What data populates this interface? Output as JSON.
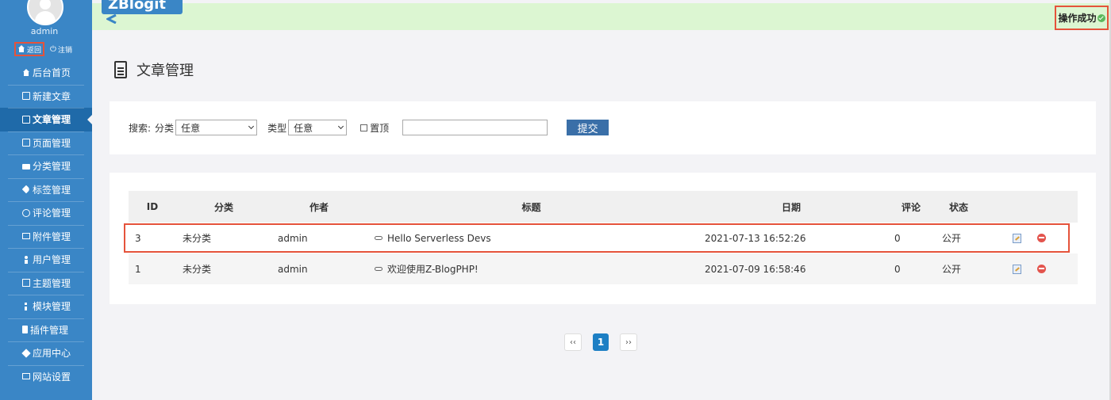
{
  "user": {
    "name": "admin",
    "back_label": "返回",
    "logout_label": "注销"
  },
  "logo": {
    "text": "ZBlogit"
  },
  "sidebar": {
    "items": [
      {
        "label": "后台首页",
        "icon": "home-icon"
      },
      {
        "label": "新建文章",
        "icon": "edit-icon"
      },
      {
        "label": "文章管理",
        "icon": "document-icon",
        "active": true
      },
      {
        "label": "页面管理",
        "icon": "page-icon"
      },
      {
        "label": "分类管理",
        "icon": "folder-icon"
      },
      {
        "label": "标签管理",
        "icon": "tag-icon"
      },
      {
        "label": "评论管理",
        "icon": "comment-icon"
      },
      {
        "label": "附件管理",
        "icon": "attachment-icon"
      },
      {
        "label": "用户管理",
        "icon": "user-icon"
      },
      {
        "label": "主题管理",
        "icon": "theme-icon"
      },
      {
        "label": "模块管理",
        "icon": "module-icon"
      },
      {
        "label": "插件管理",
        "icon": "plugin-icon"
      },
      {
        "label": "应用中心",
        "icon": "app-center-icon"
      },
      {
        "label": "网站设置",
        "icon": "settings-icon"
      }
    ]
  },
  "status": {
    "message": "操作成功"
  },
  "page": {
    "title": "文章管理"
  },
  "search": {
    "label": "搜索:",
    "category_label": "分类",
    "category_value": "任意",
    "type_label": "类型",
    "type_value": "任意",
    "top_label": "置顶",
    "keyword_value": "",
    "submit_label": "提交"
  },
  "table": {
    "headers": {
      "id": "ID",
      "category": "分类",
      "author": "作者",
      "title": "标题",
      "date": "日期",
      "comments": "评论",
      "status": "状态"
    },
    "rows": [
      {
        "id": "3",
        "category": "未分类",
        "author": "admin",
        "title": "Hello Serverless Devs",
        "date": "2021-07-13 16:52:26",
        "comments": "0",
        "status": "公开"
      },
      {
        "id": "1",
        "category": "未分类",
        "author": "admin",
        "title": "欢迎使用Z-BlogPHP!",
        "date": "2021-07-09 16:58:46",
        "comments": "0",
        "status": "公开"
      }
    ]
  },
  "pagination": {
    "prev": "‹‹",
    "current": "1",
    "next": "››"
  },
  "colors": {
    "sidebar_bg": "#3a86c6",
    "sidebar_active": "#1f6aa9",
    "success_bar": "#dcf6d2",
    "highlight_border": "#e5533b",
    "primary_button": "#3a6fa8"
  }
}
